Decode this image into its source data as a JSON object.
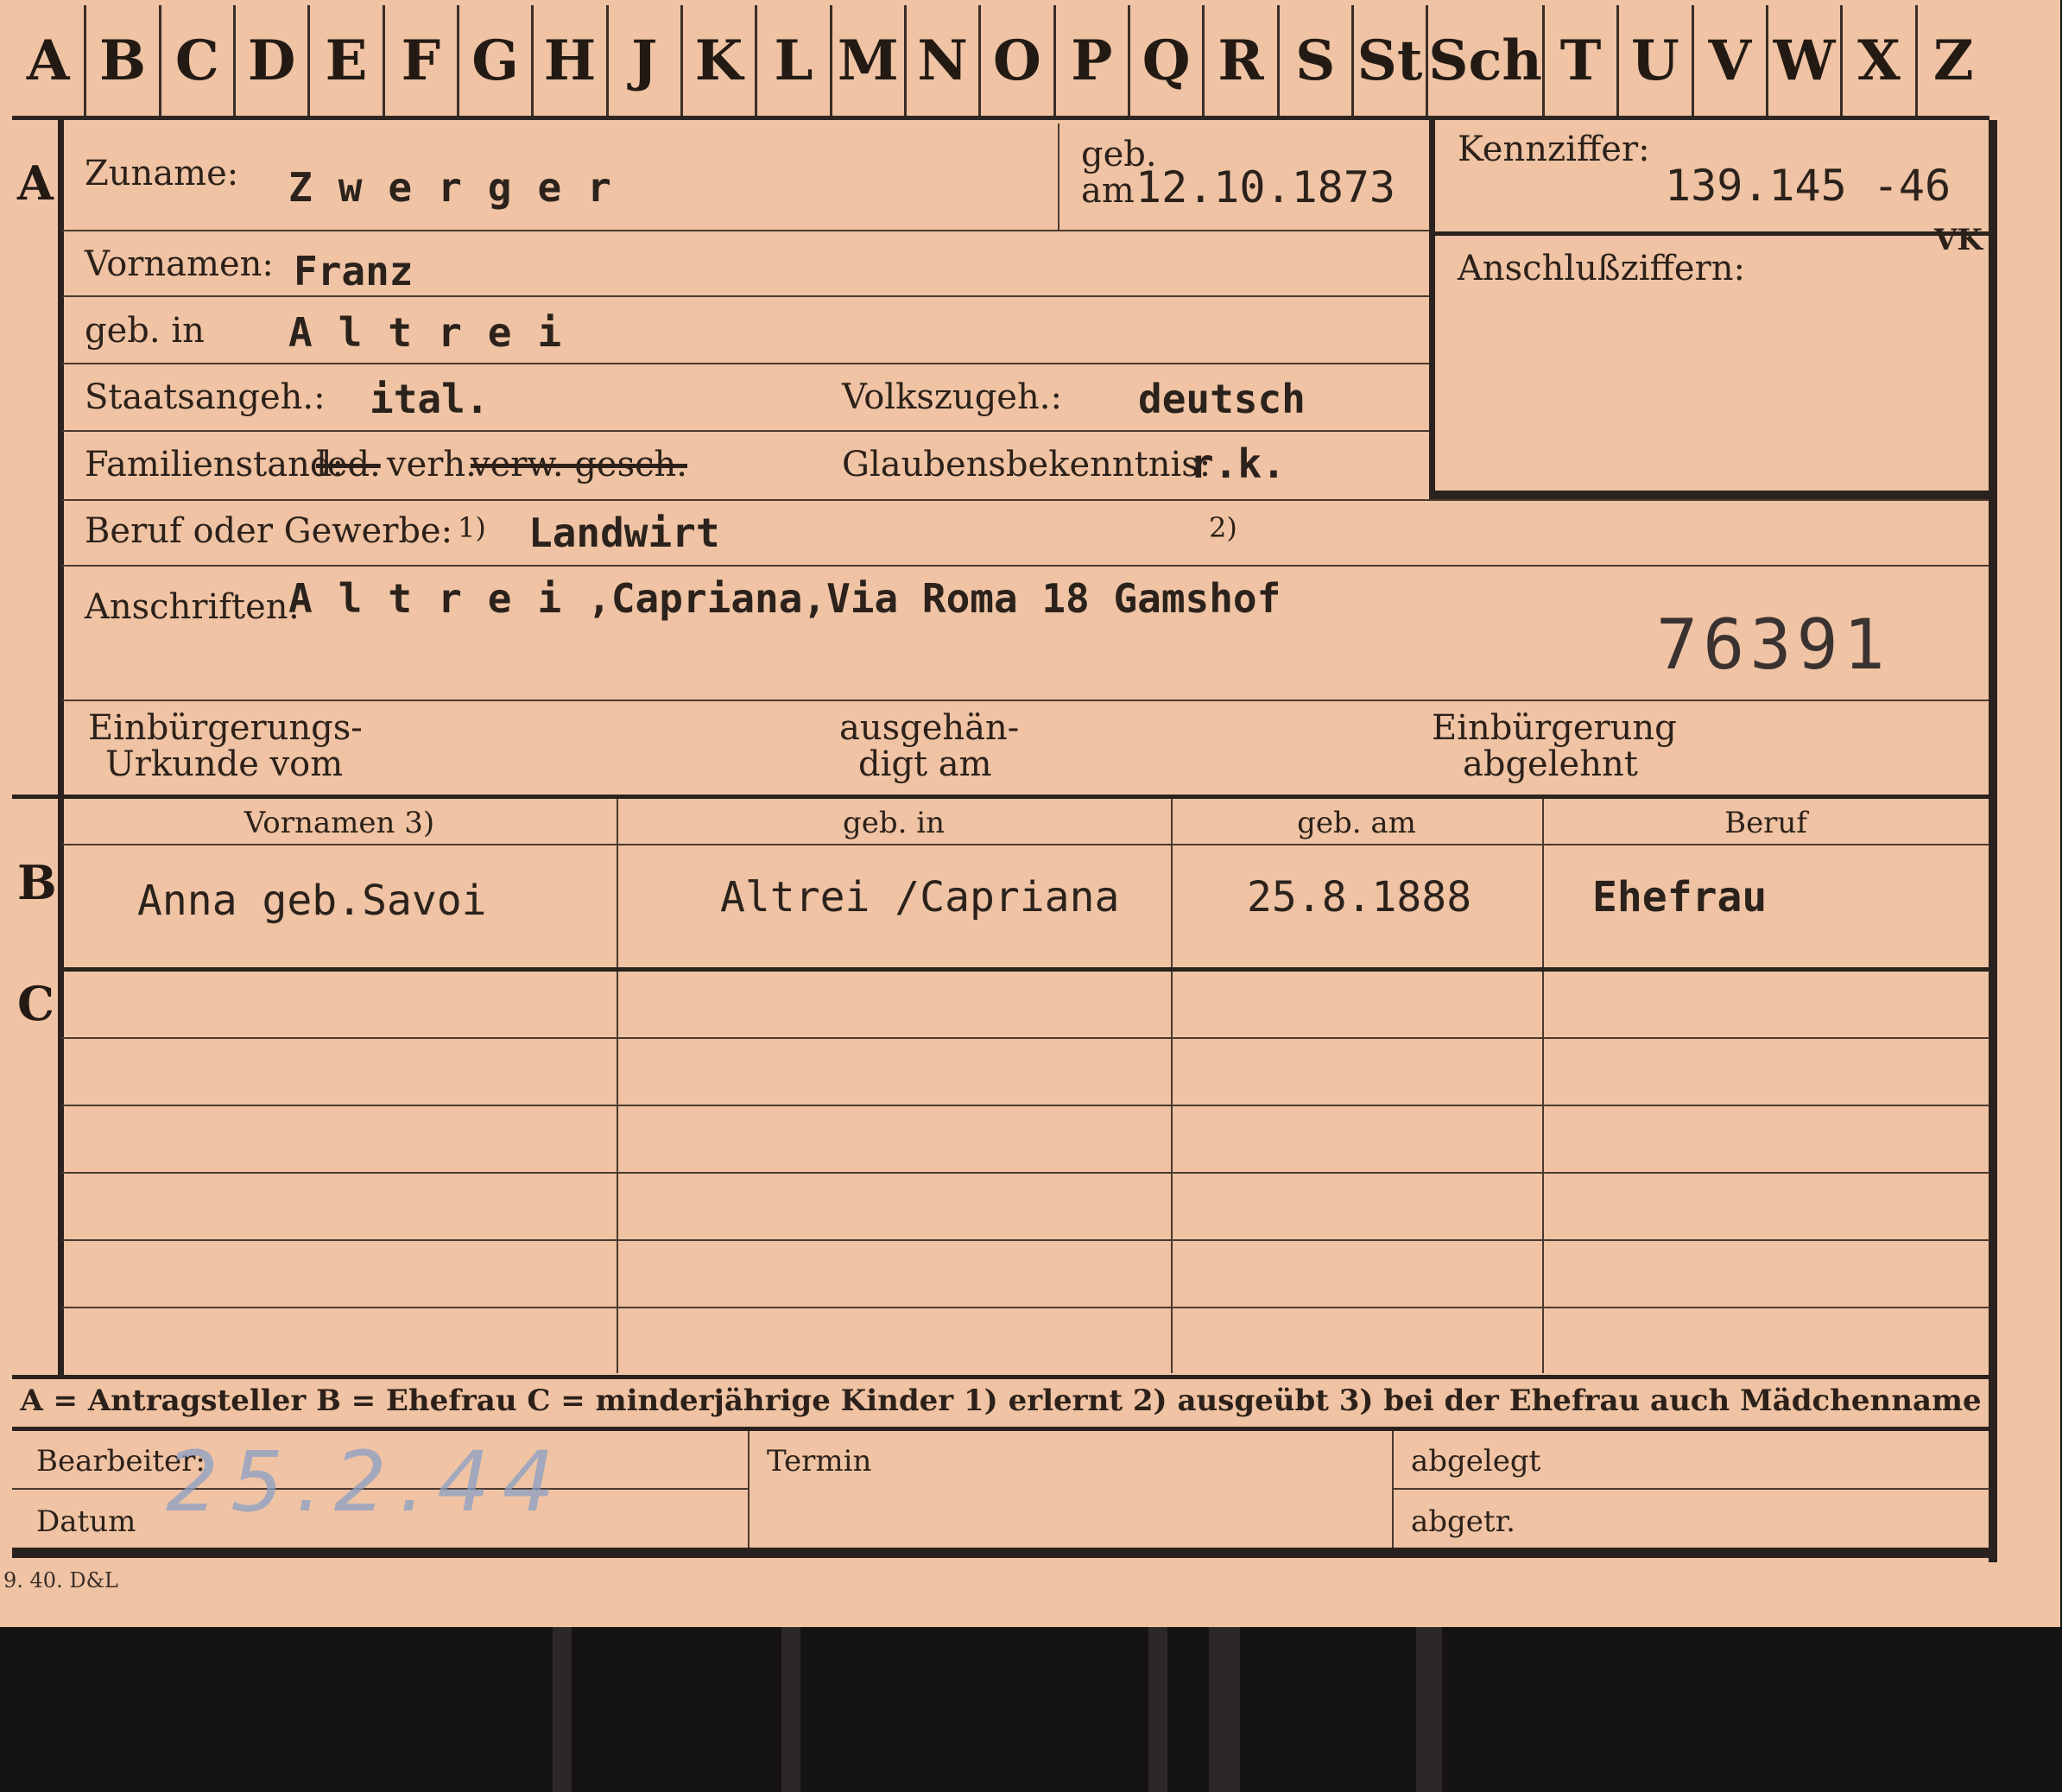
{
  "tabs": [
    "A",
    "B",
    "C",
    "D",
    "E",
    "F",
    "G",
    "H",
    "J",
    "K",
    "L",
    "M",
    "N",
    "O",
    "P",
    "Q",
    "R",
    "S",
    "St",
    "Sch",
    "T",
    "U",
    "V",
    "W",
    "X",
    "Z"
  ],
  "sections": {
    "a": "A",
    "b": "B",
    "c": "C"
  },
  "applicant": {
    "surname_label": "Zuname:",
    "surname": "Zwerger",
    "born_on_label_1": "geb.",
    "born_on_label_2": "am",
    "born_on": "12.10.1873",
    "first_names_label": "Vornamen:",
    "first_names": "Franz",
    "born_in_label": "geb. in",
    "born_in": "Altrei",
    "citizenship_label": "Staatsangeh.:",
    "citizenship": "ital.",
    "ethnicity_label": "Volkszugeh.:",
    "ethnicity": "deutsch",
    "marital_label": "Familienstand:",
    "marital_struck_1": "led.",
    "marital_value": "verh.",
    "marital_struck_2": "verw. gesch.",
    "marital_tail": "gesch.",
    "religion_label": "Glaubensbekenntnis:",
    "religion": "r.k.",
    "profession_label": "Beruf oder Gewerbe:",
    "note_1": "1)",
    "profession": "Landwirt",
    "note_2": "2)",
    "address_label": "Anschriften:",
    "address_town": "Altrei",
    "address_rest": ",Capriana,Via Roma 18 Gamshof",
    "stamp_number": "76391",
    "naturalization_label_1": "Einbürgerungs-",
    "naturalization_label_2": "Urkunde vom",
    "handed_label_1": "ausgehän-",
    "handed_label_2": "digt am",
    "rejected_label_1": "Einbürgerung",
    "rejected_label_2": "abgelehnt"
  },
  "reference": {
    "code_label": "Kennziffer:",
    "code": "139.145 -46",
    "mark": "VK",
    "linked_label": "Anschlußziffern:"
  },
  "family_table": {
    "columns": [
      "Vornamen 3)",
      "geb. in",
      "geb. am",
      "Beruf"
    ],
    "spouse": [
      "Anna geb.Savoi",
      "Altrei /Capriana",
      "25.8.1888",
      "Ehefrau"
    ]
  },
  "legend": "A = Antragsteller   B = Ehefrau   C = minderjährige Kinder   1) erlernt   2) ausgeübt   3) bei der Ehefrau auch Mädchenname",
  "footer": {
    "clerk_label": "Bearbeiter:",
    "date_label": "Datum",
    "handwritten_date": "25.2.44",
    "deadline_label": "Termin",
    "filed_label": "abgelegt",
    "filed2_label": "abgetr.",
    "print_code": "9. 40. D&L"
  }
}
